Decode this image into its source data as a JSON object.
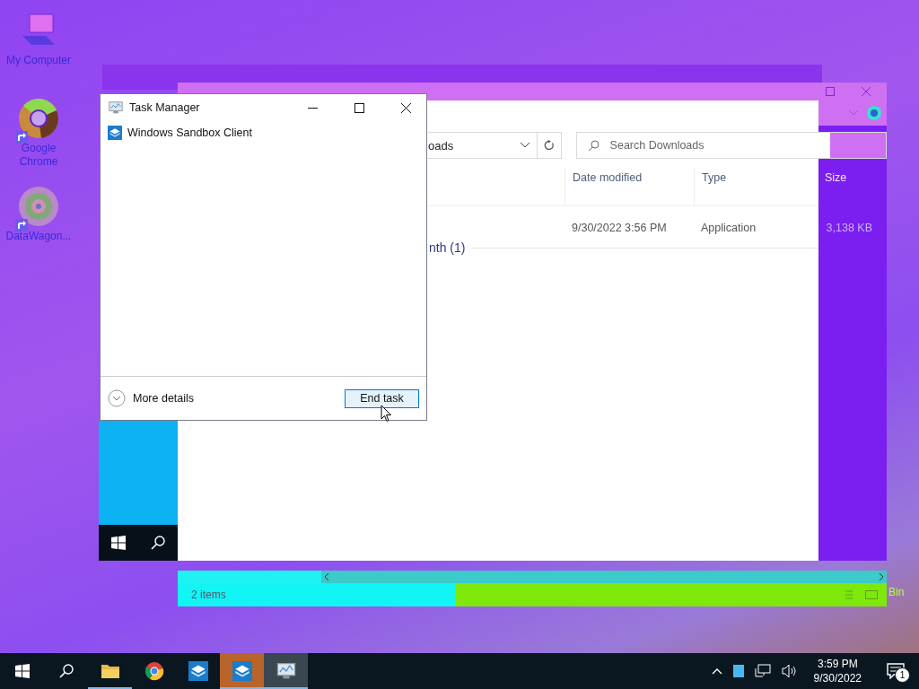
{
  "desktop_icons": [
    {
      "kind": "computer",
      "label": "My Computer",
      "shortcut": false
    },
    {
      "kind": "chrome",
      "label": "Google Chrome",
      "shortcut": true
    },
    {
      "kind": "mosaic",
      "label": "DataWagon...",
      "shortcut": true
    }
  ],
  "explorer": {
    "address": "oads",
    "search": {
      "placeholder": "Search Downloads"
    },
    "columns": [
      "Date modified",
      "Type",
      "Size"
    ],
    "rows": [
      {
        "date": "9/30/2022 3:56 PM",
        "type": "Application",
        "size": "3,138 KB"
      }
    ],
    "group": "nth (1)",
    "status": "2 items"
  },
  "recycle_label": "Bin",
  "task_manager": {
    "title": "Task Manager",
    "apps": [
      {
        "name": "Windows Sandbox Client"
      }
    ],
    "more_details": "More details",
    "end_task": "End task"
  },
  "taskbar": {
    "apps": [
      {
        "kind": "explorer",
        "open": true,
        "selected": false
      },
      {
        "kind": "chrome",
        "open": false,
        "selected": false
      },
      {
        "kind": "sandbox",
        "open": false,
        "selected": false
      },
      {
        "kind": "sandbox",
        "open": true,
        "selected": false,
        "color": "#b8642a"
      },
      {
        "kind": "taskmgr",
        "open": true,
        "selected": true
      }
    ],
    "clock": {
      "time": "3:59 PM",
      "date": "9/30/2022"
    },
    "notifications": {
      "count": "1"
    }
  }
}
